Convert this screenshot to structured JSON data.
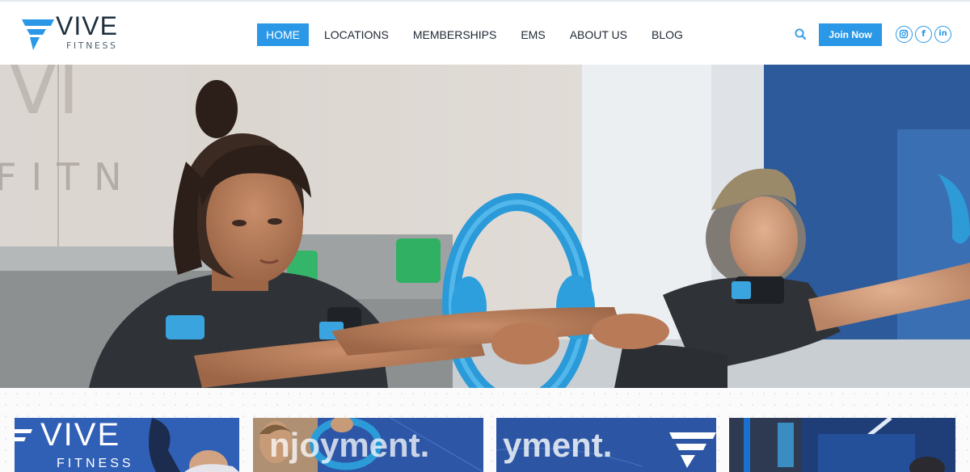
{
  "brand": {
    "name": "VIVE",
    "tagline": "FITNESS",
    "accent_color": "#2a98e6",
    "dark_color": "#1f2f3d"
  },
  "nav": {
    "items": [
      {
        "label": "HOME",
        "active": true
      },
      {
        "label": "LOCATIONS",
        "active": false
      },
      {
        "label": "MEMBERSHIPS",
        "active": false
      },
      {
        "label": "EMS",
        "active": false
      },
      {
        "label": "ABOUT US",
        "active": false
      },
      {
        "label": "BLOG",
        "active": false
      }
    ]
  },
  "header_actions": {
    "search_icon": "search-icon",
    "join_label": "Join Now",
    "social": [
      {
        "name": "instagram-icon",
        "glyph": "◎"
      },
      {
        "name": "facebook-icon",
        "glyph": "f"
      },
      {
        "name": "linkedin-icon",
        "glyph": "in"
      }
    ]
  },
  "hero": {
    "photo": "two women doing EMS training with blue pilates rings",
    "wall_logo_text": "VI",
    "wall_sub_text": "FITN"
  },
  "cards": [
    {
      "text_main": "VIVE",
      "text_sub": "FITNESS"
    },
    {
      "text_main": "njoyment."
    },
    {
      "text_main": "yment."
    },
    {
      "text_main": ""
    }
  ]
}
